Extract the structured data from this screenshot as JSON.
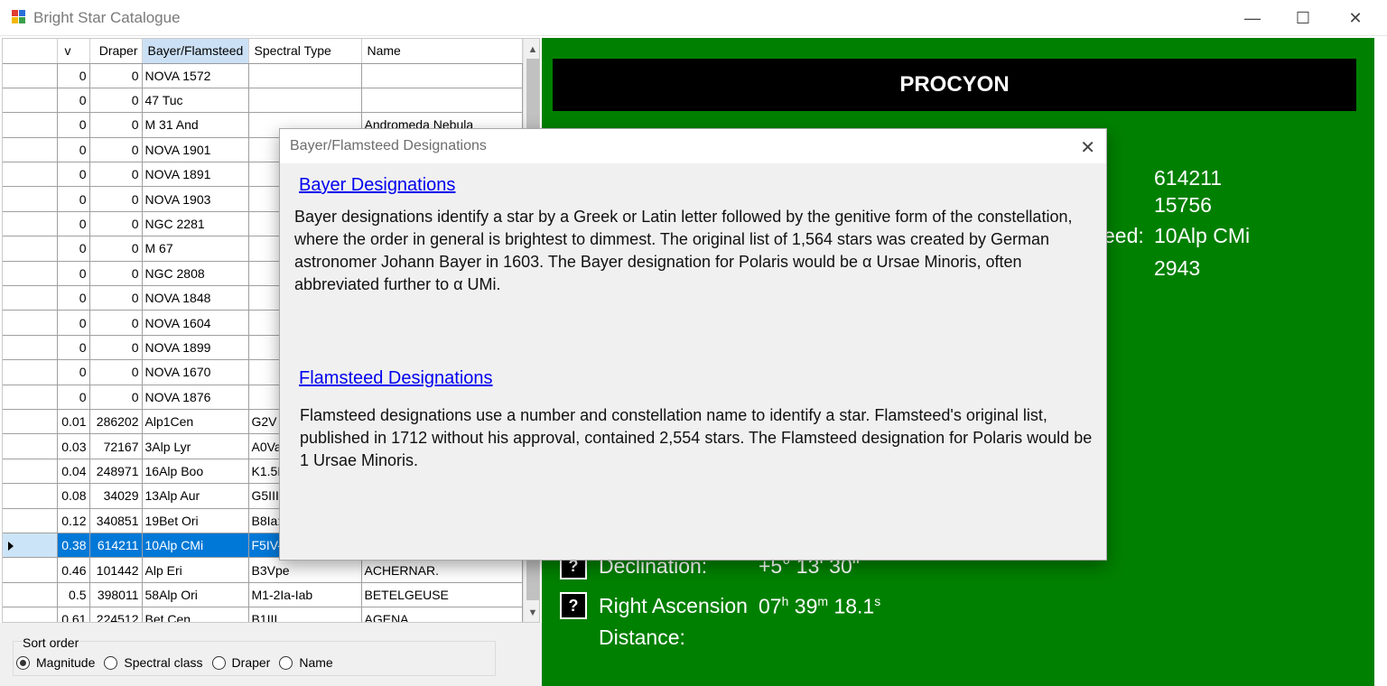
{
  "window": {
    "title": "Bright Star Catalogue",
    "minimize_glyph": "—",
    "maximize_glyph": "☐",
    "close_glyph": "✕"
  },
  "grid": {
    "columns": [
      "v",
      "Draper",
      "Bayer/Flamsteed",
      "Spectral Type",
      "Name"
    ],
    "sorted_column": "Bayer/Flamsteed",
    "selected_row_index": 19,
    "rows": [
      [
        "0",
        "0",
        "NOVA 1572",
        "",
        ""
      ],
      [
        "0",
        "0",
        "47   Tuc",
        "",
        ""
      ],
      [
        "0",
        "0",
        "M 31  And",
        "",
        "Andromeda Nebula"
      ],
      [
        "0",
        "0",
        "NOVA 1901",
        "",
        ""
      ],
      [
        "0",
        "0",
        "NOVA 1891",
        "",
        ""
      ],
      [
        "0",
        "0",
        "NOVA 1903",
        "",
        ""
      ],
      [
        "0",
        "0",
        "NGC 2281",
        "",
        ""
      ],
      [
        "0",
        "0",
        "M 67",
        "",
        ""
      ],
      [
        "0",
        "0",
        "NGC 2808",
        "",
        ""
      ],
      [
        "0",
        "0",
        "NOVA 1848",
        "",
        ""
      ],
      [
        "0",
        "0",
        "NOVA 1604",
        "",
        ""
      ],
      [
        "0",
        "0",
        "NOVA 1899",
        "",
        ""
      ],
      [
        "0",
        "0",
        "NOVA 1670",
        "",
        ""
      ],
      [
        "0",
        "0",
        "NOVA 1876",
        "",
        ""
      ],
      [
        "0.01",
        "286202",
        "Alp1Cen",
        "G2V",
        ""
      ],
      [
        "0.03",
        "72167",
        "3Alp Lyr",
        "A0Va",
        ""
      ],
      [
        "0.04",
        "248971",
        "16Alp Boo",
        "K1.5I",
        ""
      ],
      [
        "0.08",
        "34029",
        "13Alp Aur",
        "G5IIIe",
        ""
      ],
      [
        "0.12",
        "340851",
        "19Bet Ori",
        "B8Ia:",
        ""
      ],
      [
        "0.38",
        "614211",
        "10Alp CMi",
        "F5IV-",
        ""
      ],
      [
        "0.46",
        "101442",
        "Alp Eri",
        "B3Vpe",
        "ACHERNAR."
      ],
      [
        "0.5",
        "398011",
        "58Alp Ori",
        "M1-2Ia-Iab",
        "BETELGEUSE"
      ],
      [
        "0.61",
        "224512",
        "Bet Cen",
        "B1III",
        "AGENA"
      ]
    ]
  },
  "sort_order": {
    "label": "Sort order",
    "options": [
      "Magnitude",
      "Spectral class",
      "Draper",
      "Name"
    ],
    "selected": "Magnitude"
  },
  "detail": {
    "star_name": "PROCYON",
    "values": {
      "v1": "614211",
      "v2": "15756",
      "bayer_partial_label": "eed:",
      "bayer_value": "10Alp CMi",
      "v4": "2943"
    },
    "declination_label": "Declination:",
    "declination_value": "+5° 13' 30\"",
    "ra_label": "Right Ascension",
    "ra_h": "07",
    "ra_h_unit": "h",
    "ra_m": "39",
    "ra_m_unit": "m",
    "ra_s": "18.1",
    "ra_s_unit": "s",
    "distance_label": "Distance:",
    "help_glyph": "?"
  },
  "dialog": {
    "title": "Bayer/Flamsteed Designations",
    "close_glyph": "✕",
    "bayer_link": "Bayer Designations",
    "bayer_text": "Bayer designations identify a star by a Greek or Latin letter followed by the genitive form of the constellation, where the order in general is brightest to dimmest.  The original list of 1,564 stars was created by German astronomer Johann Bayer in 1603.  The Bayer designation for Polaris would be α Ursae Minoris, often abbreviated further to α UMi.",
    "flamsteed_link": "Flamsteed Designations",
    "flamsteed_text": "Flamsteed designations use a number and constellation name to identify a star. Flamsteed's original list, published in 1712 without his approval, contained 2,554 stars.  The Flamsteed designation for Polaris would be 1 Ursae Minoris."
  },
  "colors": {
    "panel_green": "#008000",
    "selection_blue": "#0078d7",
    "link_blue": "#0000ee"
  }
}
